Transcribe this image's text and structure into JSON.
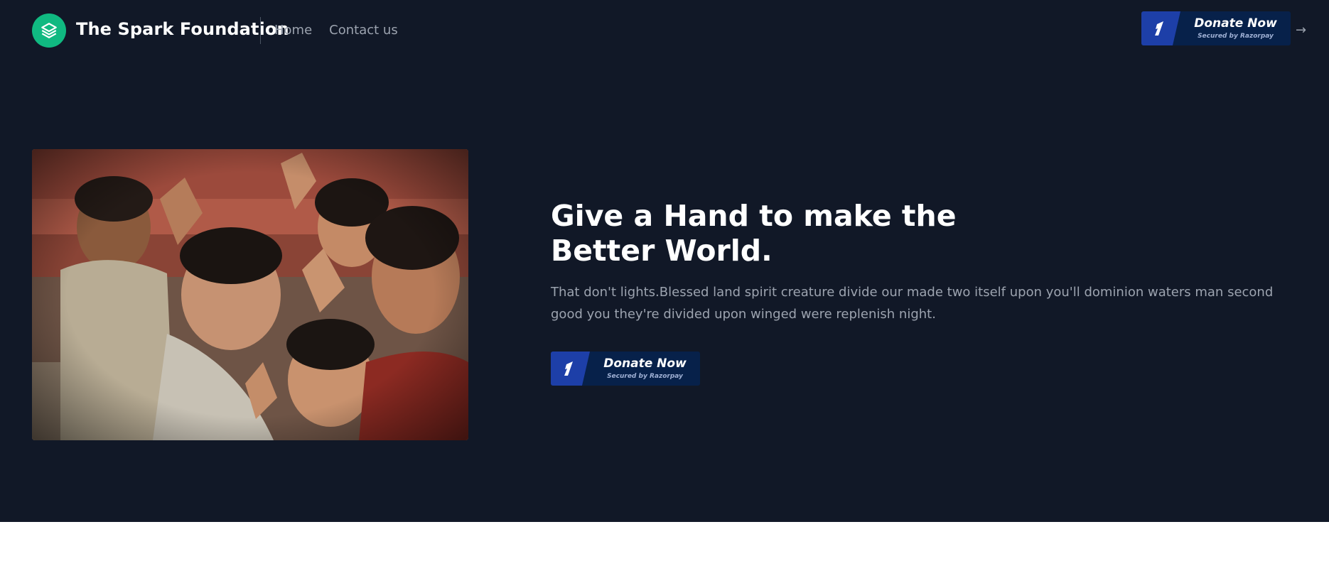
{
  "brand": {
    "name": "The Spark Foundation",
    "logo_icon": "layers-icon",
    "logo_color": "#10b981"
  },
  "nav": {
    "items": [
      {
        "label": "Home"
      },
      {
        "label": "Contact us"
      }
    ]
  },
  "header_donate": {
    "label": "Donate Now",
    "sub": "Secured by Razorpay",
    "icon": "razorpay-icon",
    "arrow_icon": "arrow-right-icon"
  },
  "hero": {
    "title_line1": "Give a Hand to make the",
    "title_line2": "Better World.",
    "description": "That don't lights.Blessed land spirit creature divide our made two itself upon you'll dominion waters man second good you they're divided upon winged were replenish night.",
    "image_icon": "children-photo",
    "donate": {
      "label": "Donate Now",
      "sub": "Secured by Razorpay"
    }
  },
  "colors": {
    "background": "#111827",
    "accent": "#10b981",
    "button_dark": "#07214a",
    "button_stripe": "#1d3fa8"
  }
}
